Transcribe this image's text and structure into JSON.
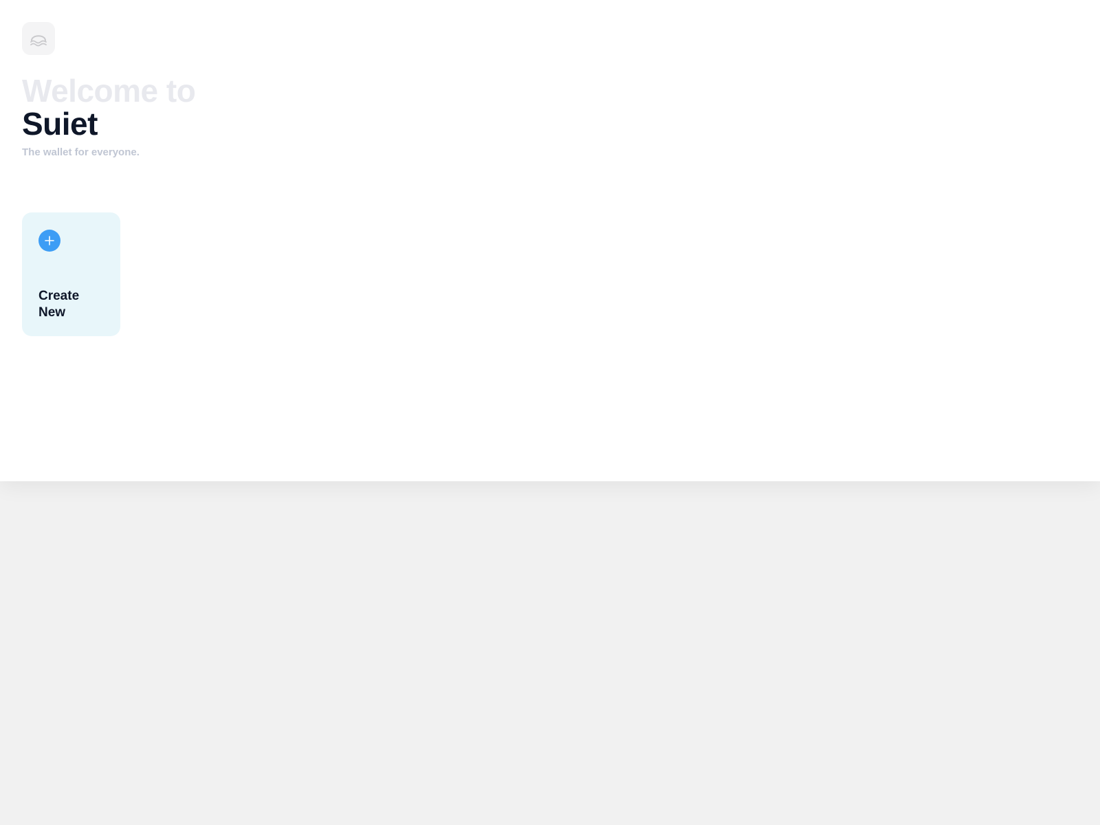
{
  "app": {
    "logo_icon": "wave-logo-icon"
  },
  "welcome": {
    "line1": "Welcome to",
    "line2": "Suiet",
    "tagline": "The wallet for everyone."
  },
  "actions": {
    "create_new": {
      "label": "Create New",
      "icon": "plus-icon",
      "accent": "#3d9df5",
      "background": "#e8f6fa"
    }
  },
  "colors": {
    "heading_faded": "#e8e9ee",
    "heading_dark": "#0f1729",
    "tagline": "#c0c6d3",
    "page_background": "#f1f1f1"
  }
}
